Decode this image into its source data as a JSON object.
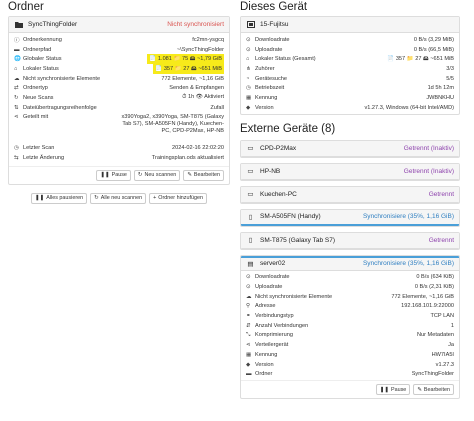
{
  "left": {
    "title": "Ordner",
    "folder": {
      "name": "SyncThingFolder",
      "status": "Nicht synchronisiert",
      "rows": [
        {
          "icon": "info-icon",
          "label": "Ordnerkennung",
          "value": "fc2mn-ysgcq"
        },
        {
          "icon": "folder-icon",
          "label": "Ordnerpfad",
          "value": "~\\SyncThingFolder"
        },
        {
          "icon": "globe-icon",
          "label": "Globaler Status",
          "value": "📄 1.081  📁 75  🖴 ~1,79 GiB"
        },
        {
          "icon": "home-icon",
          "label": "Lokaler Status",
          "value": "📄 357  📁 27  🖴 ~651 MiB"
        },
        {
          "icon": "cloud-icon",
          "label": "Nicht synchronisierte Elemente",
          "value": "772 Elemente, ~1,16 GiB"
        },
        {
          "icon": "exchange-icon",
          "label": "Ordnertyp",
          "value": "Senden & Empfangen"
        },
        {
          "icon": "refresh-icon",
          "label": "Neue Scans",
          "value": "⏱ 1h  👁 Aktiviert"
        },
        {
          "icon": "order-icon",
          "label": "Dateiübertragungsreihenfolge",
          "value": "Zufall"
        },
        {
          "icon": "share-icon",
          "label": "Geteilt mit",
          "value": "x390Yoga2, x390Yoga, SM-T875 (Galaxy Tab S7), SM-A505FN (Handy), Kuechen-PC, CPD-P2Max, HP-NB"
        },
        {
          "icon": "clock-icon",
          "label": "Letzter Scan",
          "value": "2024-02-16 22:02:20"
        },
        {
          "icon": "swap-icon",
          "label": "Letzte Änderung",
          "value": "Trainingsplan.ods aktualisiert"
        }
      ],
      "buttons": [
        {
          "icon": "pause-icon",
          "label": "Pause"
        },
        {
          "icon": "refresh-icon",
          "label": "Neu scannen"
        },
        {
          "icon": "pencil-icon",
          "label": "Bearbeiten"
        }
      ]
    },
    "footer_buttons": [
      {
        "icon": "pause-icon",
        "label": "Alles pausieren"
      },
      {
        "icon": "refresh-icon",
        "label": "Alle neu scannen"
      },
      {
        "icon": "plus-icon",
        "label": "Ordner hinzufügen"
      }
    ]
  },
  "right": {
    "title": "Dieses Gerät",
    "this_device": {
      "name": "15-Fujitsu",
      "rows": [
        {
          "icon": "download-icon",
          "label": "Downloadrate",
          "value": "0 B/s (3,29 MiB)"
        },
        {
          "icon": "upload-icon",
          "label": "Uploadrate",
          "value": "0 B/s (66,5 MiB)"
        },
        {
          "icon": "home-icon",
          "label": "Lokaler Status (Gesamt)",
          "value": "📄 357  📁 27  🖴 ~651 MiB"
        },
        {
          "icon": "sitemap-icon",
          "label": "Zuhörer",
          "value": "3/3"
        },
        {
          "icon": "signal-icon",
          "label": "Gerätesuche",
          "value": "5/5"
        },
        {
          "icon": "clock-icon",
          "label": "Betriebszeit",
          "value": "1d 5h 12m"
        },
        {
          "icon": "qrcode-icon",
          "label": "Kennung",
          "value": "JWBNKHU"
        },
        {
          "icon": "tag-icon",
          "label": "Version",
          "value": "v1.27.3, Windows (64-bit Intel/AMD)"
        }
      ]
    },
    "external_title": "Externe Geräte (8)",
    "devices": [
      {
        "name": "CPD-P2Max",
        "status": "Getrennt (Inaktiv)",
        "color": "#8e44ad",
        "icon": "laptop-icon"
      },
      {
        "name": "HP-NB",
        "status": "Getrennt (Inaktiv)",
        "color": "#8e44ad",
        "icon": "laptop-icon"
      },
      {
        "name": "Kuechen-PC",
        "status": "Getrennt",
        "color": "#8e44ad",
        "icon": "laptop-icon"
      },
      {
        "name": "SM-A505FN (Handy)",
        "status": "Synchronisiere (35%, 1,16 GiB)",
        "color": "#2f7fc1",
        "icon": "mobile-icon"
      },
      {
        "name": "SM-T875 (Galaxy Tab S7)",
        "status": "Getrennt",
        "color": "#8e44ad",
        "icon": "tablet-icon"
      }
    ],
    "server": {
      "name": "server02",
      "status": "Synchronisiere (35%, 1,16 GiB)",
      "rows": [
        {
          "icon": "download-icon",
          "label": "Downloadrate",
          "value": "0 B/s (634 KiB)"
        },
        {
          "icon": "upload-icon",
          "label": "Uploadrate",
          "value": "0 B/s (2,31 KiB)"
        },
        {
          "icon": "cloud-icon",
          "label": "Nicht synchronisierte Elemente",
          "value": "772 Elemente, ~1,16 GiB"
        },
        {
          "icon": "link-icon",
          "label": "Adresse",
          "value": "192.168.101.9:22000"
        },
        {
          "icon": "link-icon",
          "label": "Verbindungstyp",
          "value": "TCP LAN"
        },
        {
          "icon": "connections-icon",
          "label": "Anzahl Verbindungen",
          "value": "1"
        },
        {
          "icon": "compress-icon",
          "label": "Komprimierung",
          "value": "Nur Metadaten"
        },
        {
          "icon": "share-icon",
          "label": "Verteilergerät",
          "value": "Ja"
        },
        {
          "icon": "qrcode-icon",
          "label": "Kennung",
          "value": "HW7IA5I"
        },
        {
          "icon": "tag-icon",
          "label": "Version",
          "value": "v1.27.3"
        },
        {
          "icon": "folder-icon",
          "label": "Ordner",
          "value": "SyncThingFolder"
        }
      ],
      "buttons": [
        {
          "icon": "pause-icon",
          "label": "Pause"
        },
        {
          "icon": "pencil-icon",
          "label": "Bearbeiten"
        }
      ]
    }
  },
  "colors": {
    "not_synced": "#d9534f",
    "disconnected": "#8e44ad",
    "syncing": "#2f7fc1",
    "up_to_date": "#3c9a3c",
    "highlight": "#f7ea1a"
  }
}
